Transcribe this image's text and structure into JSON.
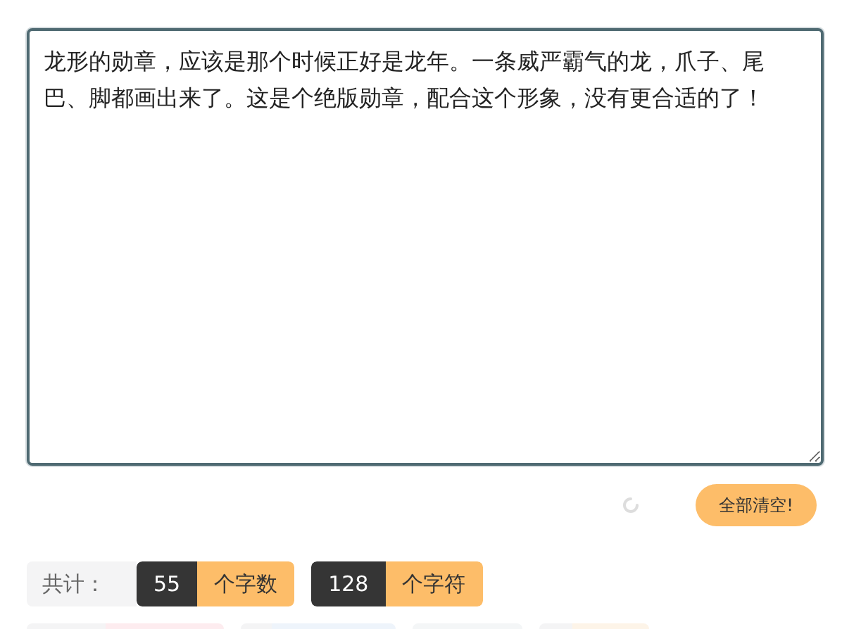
{
  "editor": {
    "value": "龙形的勋章，应该是那个时候正好是龙年。一条威严霸气的龙，爪子、尾巴、脚都画出来了。这是个绝版勋章，配合这个形象，没有更合适的了！"
  },
  "actions": {
    "clear_button": "全部清空!",
    "loading": true
  },
  "stats": {
    "label": "共计：",
    "counts": [
      {
        "value": "55",
        "unit": "个字数"
      },
      {
        "value": "128",
        "unit": "个字符"
      }
    ]
  }
}
